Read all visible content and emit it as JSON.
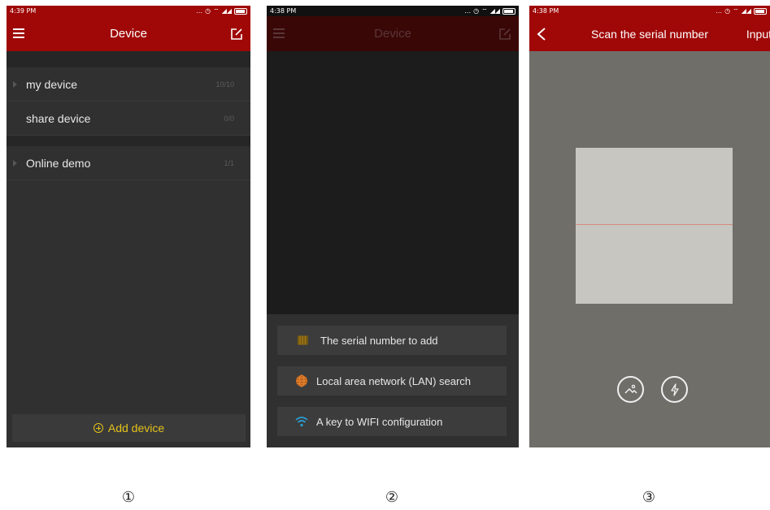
{
  "panel1": {
    "status_time": "4:39 PM",
    "title": "Device",
    "menu_icon": "hamburger-menu-icon",
    "edit_icon": "edit-square-icon",
    "rows": [
      {
        "label": "my device",
        "count": "10/10",
        "arrow": true
      },
      {
        "label": "share device",
        "count": "0/0",
        "arrow": false
      },
      {
        "label": "Online demo",
        "count": "1/1",
        "arrow": true
      }
    ],
    "add_device_label": "Add device",
    "accent": "#e4c21b",
    "bar_color": "#9f0807"
  },
  "panel2": {
    "status_time": "4:38 PM",
    "title": "Device",
    "options": [
      {
        "label": "The serial number to add",
        "icon": "barcode-icon"
      },
      {
        "label": "Local area network (LAN) search",
        "icon": "globe-icon"
      },
      {
        "label": "A key to WIFI configuration",
        "icon": "wifi-icon"
      }
    ]
  },
  "panel3": {
    "status_time": "4:38 PM",
    "title": "Scan the serial number",
    "input_label": "Input",
    "buttons": [
      "gallery-icon",
      "flash-icon"
    ]
  },
  "captions": [
    "①",
    "②",
    "③"
  ]
}
